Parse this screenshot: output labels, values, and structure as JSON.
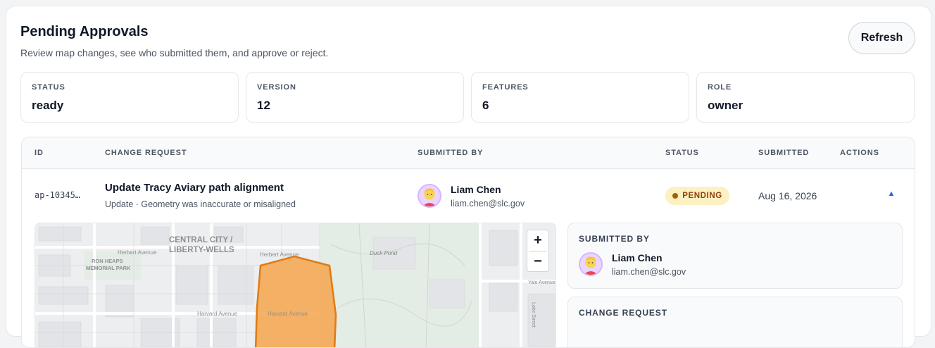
{
  "header": {
    "title": "Pending Approvals",
    "subtitle": "Review map changes, see who submitted them, and approve or reject.",
    "refresh_label": "Refresh"
  },
  "stats": [
    {
      "label": "STATUS",
      "value": "ready"
    },
    {
      "label": "VERSION",
      "value": "12"
    },
    {
      "label": "FEATURES",
      "value": "6"
    },
    {
      "label": "ROLE",
      "value": "owner"
    }
  ],
  "table": {
    "columns": {
      "id": "ID",
      "change_request": "CHANGE REQUEST",
      "submitted_by": "SUBMITTED BY",
      "status": "STATUS",
      "submitted": "SUBMITTED",
      "actions": "ACTIONS"
    },
    "row": {
      "id": "ap-10345…",
      "title": "Update Tracy Aviary path alignment",
      "subtitle": "Update · Geometry was inaccurate or misaligned",
      "user_name": "Liam Chen",
      "user_email": "liam.chen@slc.gov",
      "status": "PENDING",
      "date": "Aug 16, 2026",
      "expand_icon": "caret-up-icon"
    }
  },
  "map": {
    "labels": {
      "district": "CENTRAL CITY /",
      "district2": "LIBERTY-WELLS",
      "street1": "Herbert Avenue",
      "street2": "Herbert Avenue",
      "park1": "RON HEAPS",
      "park2": "MEMORIAL PARK",
      "pond": "Duck Pond",
      "street3": "Harvard Avenue",
      "street4": "Harvard Avenue",
      "street5": "Yale Avenue",
      "street6": "Lake Street"
    },
    "zoom_in": "+",
    "zoom_out": "−",
    "polygon_color": "#f6a54c",
    "polygon_stroke": "#e07b12"
  },
  "detail": {
    "submitted_by_label": "SUBMITTED BY",
    "user_name": "Liam Chen",
    "user_email": "liam.chen@slc.gov",
    "change_request_label": "CHANGE REQUEST"
  },
  "colors": {
    "accent": "#2563eb",
    "pending_bg": "#fdf0c2",
    "pending_text": "#92400e"
  }
}
